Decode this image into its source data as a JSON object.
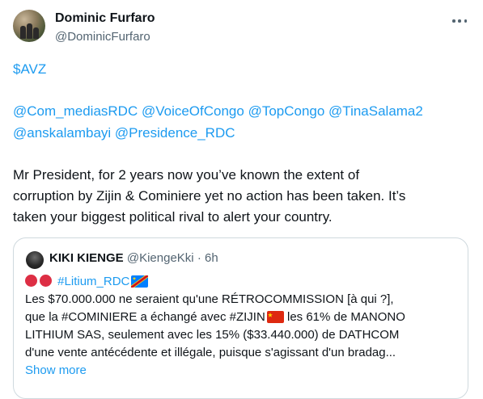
{
  "tweet": {
    "author_name": "Dominic Furfaro",
    "author_handle": "@DominicFurfaro",
    "ticker": "$AVZ",
    "mentions_line1": "@Com_mediasRDC @VoiceOfCongo @TopCongo @TinaSalama2",
    "mentions_line2": "@anskalambayi @Presidence_RDC",
    "body_lines": [
      "Mr President, for 2 years now you’ve known the extent of",
      "corruption by Zijin & Cominiere yet no action has been taken. It’s",
      "taken your biggest political rival to alert your country."
    ]
  },
  "quoted": {
    "author_name": "KIKI KIENGE",
    "author_handle": "@KiengeKki",
    "time": "· 6h",
    "hashtag": "#Litium_RDC",
    "line2": "Les $70.000.000 ne seraient qu'une RÉTROCOMMISSION [à qui ?],",
    "line3_before": "que la #COMINIERE a échangé avec #ZIJIN",
    "line3_after": " les 61% de MANONO",
    "line4": "LITHIUM SAS, seulement avec les 15% ($33.440.000) de DATHCOM",
    "line5": "d'une vente antécédente et illégale, puisque s'agissant d'un bradag...",
    "show_more": "Show more"
  },
  "icons": {
    "more": "more-horizontal-icon",
    "red_circle": "red-circle-emoji",
    "drc_flag": "drc-flag-emoji",
    "china_flag": "china-flag-emoji"
  },
  "colors": {
    "link": "#1d9bf0",
    "text": "#0f1419",
    "secondary": "#536471",
    "border": "#cfd9de"
  }
}
